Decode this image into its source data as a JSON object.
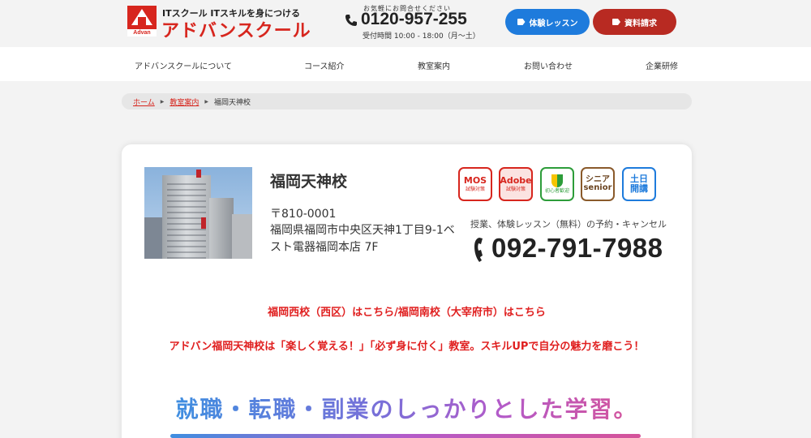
{
  "header": {
    "logo": {
      "tagline": "ITスクール ITスキルを身につける",
      "name": "アドバンスクール",
      "mark_text": "Advan"
    },
    "contact": {
      "caption": "お気軽にお問合せください",
      "number": "0120-957-255",
      "hours": "受付時間 10:00 - 18:00（月〜土）"
    },
    "buttons": {
      "trial_label": "体験レッスン",
      "docs_label": "資料請求"
    },
    "colors": {
      "brand_red": "#d7261e",
      "trial_blue": "#1e7bdc",
      "docs_red": "#b82a22"
    }
  },
  "nav": {
    "items": [
      {
        "label": "アドバンスクールについて"
      },
      {
        "label": "コース紹介"
      },
      {
        "label": "教室案内"
      },
      {
        "label": "お問い合わせ"
      },
      {
        "label": "企業研修"
      }
    ]
  },
  "breadcrumb": {
    "home": "ホーム",
    "classrooms": "教室案内",
    "current": "福岡天神校"
  },
  "school": {
    "name": "福岡天神校",
    "postal": "〒810-0001",
    "address": "福岡県福岡市中央区天神1丁目9-1ベスト電器福岡本店 7F",
    "badges": {
      "mos_main": "MOS",
      "mos_sub": "試験対策",
      "adobe_main": "Adobe",
      "adobe_sub": "試験対策",
      "beginner_sub": "初心者歓迎",
      "senior_main_1": "シニア",
      "senior_main_2": "senior",
      "weekend_main_1": "土日",
      "weekend_main_2": "開講"
    },
    "reservation_caption": "授業、体験レッスン（無料）の予約・キャンセル",
    "reservation_phone": "092-791-7988"
  },
  "content": {
    "other_schools": "福岡西校（西区）はこちら/福岡南校（大宰府市）はこちら",
    "intro": "アドバン福岡天神校は「楽しく覚える！」「必ず身に付く」教室。スキルUPで自分の魅力を磨こう！",
    "slogan": "就職・転職・副業のしっかりとした学習。"
  }
}
